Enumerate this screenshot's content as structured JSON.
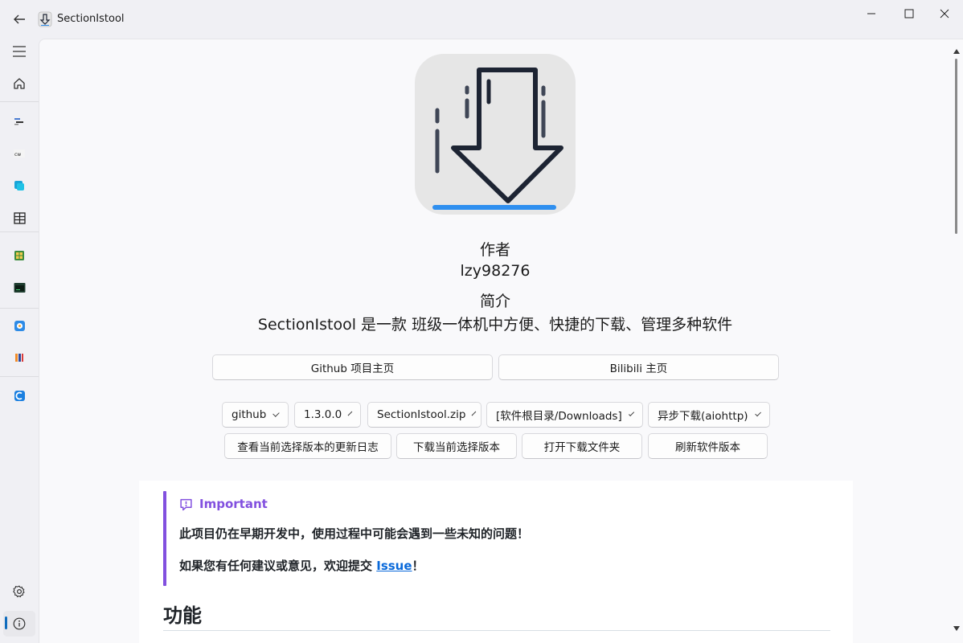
{
  "window": {
    "title": "SectionIstool",
    "controls": {
      "minimize_icon": "minimize-icon",
      "maximize_icon": "maximize-icon",
      "close_icon": "close-icon"
    }
  },
  "nav": {
    "top_icons": [
      "hamburger-menu-icon",
      "home-icon"
    ],
    "app_icons": [
      "app-icon-1",
      "app-icon-2",
      "app-icon-3",
      "app-icon-4",
      "app-icon-5",
      "app-icon-6",
      "app-icon-7",
      "app-icon-8",
      "app-icon-9"
    ],
    "bottom_icons": [
      "settings-icon",
      "info-icon"
    ],
    "selected": "info-icon"
  },
  "about": {
    "author_label": "作者",
    "author_name": "lzy98276",
    "intro_label": "简介",
    "intro_text": "SectionIstool 是一款 班级一体机中方便、快捷的下载、管理多种软件"
  },
  "links": {
    "github": "Github 项目主页",
    "bilibili": "Bilibili 主页"
  },
  "download": {
    "source": "github",
    "version": "1.3.0.0",
    "file": "SectionIstool.zip",
    "path": "[软件根目录/Downloads]",
    "mode": "异步下载(aiohttp)",
    "changelog_button": "查看当前选择版本的更新日志",
    "download_button": "下载当前选择版本",
    "open_folder_button": "打开下载文件夹",
    "refresh_button": "刷新软件版本"
  },
  "readme": {
    "alert_title": "Important",
    "alert_line1": "此项目仍在早期开发中，使用过程中可能会遇到一些未知的问题！",
    "alert_line2_prefix": "如果您有任何建议或意见，欢迎提交 ",
    "alert_line2_link": "Issue",
    "alert_line2_suffix": "！",
    "heading": "功能"
  },
  "colors": {
    "accent": "#0f6cbd",
    "important": "#8250df",
    "link": "#0969da",
    "logo_bar": "#2f8fef"
  }
}
